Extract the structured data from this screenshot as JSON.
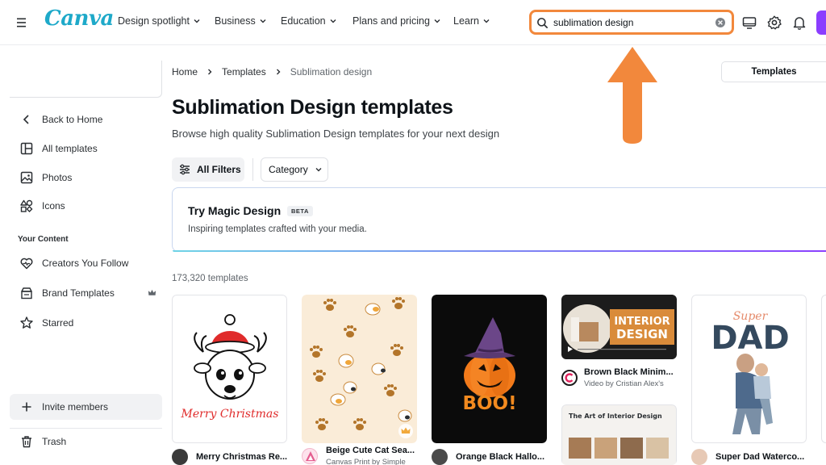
{
  "app": {
    "logo": "Canva"
  },
  "nav": [
    "Design spotlight",
    "Business",
    "Education",
    "Plans and pricing",
    "Learn"
  ],
  "search": {
    "value": "sublimation design"
  },
  "sidebar": {
    "back": "Back to Home",
    "items": [
      "All templates",
      "Photos",
      "Icons"
    ],
    "section_heading": "Your Content",
    "content_items": [
      "Creators You Follow",
      "Brand Templates",
      "Starred"
    ],
    "invite": "Invite members",
    "trash": "Trash"
  },
  "breadcrumb": [
    "Home",
    "Templates",
    "Sublimation design"
  ],
  "tab": "Templates",
  "page": {
    "title": "Sublimation Design templates",
    "subtitle": "Browse high quality Sublimation Design templates for your next design"
  },
  "filters": {
    "all": "All Filters",
    "category": "Category"
  },
  "magic": {
    "title": "Try Magic Design",
    "badge": "BETA",
    "desc": "Inspiring templates crafted with your media."
  },
  "results_count": "173,320 templates",
  "cards": [
    {
      "title": "Merry Christmas Re...",
      "art_text": "Merry Christmas"
    },
    {
      "title": "Beige Cute Cat Sea...",
      "subtitle": "Canvas Print by Simple"
    },
    {
      "title": "Orange Black Hallo...",
      "art_text": "BOO!"
    },
    {
      "title": "Brown Black Minim...",
      "subtitle": "Video by Cristian Alex's",
      "art_text_1": "INTERIOR",
      "art_text_2": "DESIGN",
      "art_text_3": "The Art of Interior Design"
    },
    {
      "title": "Super Dad Waterco...",
      "art_text_1": "Super",
      "art_text_2": "DAD"
    }
  ],
  "colors": {
    "brand": "#1ea9c9",
    "accent": "#8b3dff",
    "search_highlight": "#f2883c",
    "annotation_arrow": "#f2883c"
  }
}
